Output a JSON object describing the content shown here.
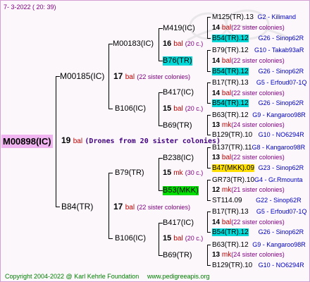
{
  "header": {
    "date": "7-  3-2022 ( 20: 39)"
  },
  "root": {
    "id": "M00898(IC)",
    "count": "19",
    "unit": "bal",
    "note": "(Drones from 20 sister colonies)"
  },
  "g1": [
    {
      "id": "M00185(IC)",
      "count": "17",
      "unit": "bal",
      "note": "(22 sister colonies)"
    },
    {
      "id": "B84(TR)",
      "count": "17",
      "unit": "bal",
      "note": "(22 sister colonies)"
    }
  ],
  "g2": [
    {
      "id": "M00183(IC)"
    },
    {
      "id": "B106(IC)",
      "count": "15",
      "unit": "bal",
      "note": "(20 c.)"
    },
    {
      "id": "B79(TR)",
      "count": "15",
      "unit": "mk",
      "note": "(30 c.)"
    },
    {
      "id": "B106(IC)",
      "count": "15",
      "unit": "bal",
      "note": "(20 c.)"
    }
  ],
  "g3": [
    {
      "id": "M419(IC)",
      "count": "16",
      "unit": "bal",
      "note": "(20 c.)"
    },
    {
      "id": "B76(TR)"
    },
    {
      "id": "B417(IC)"
    },
    {
      "id": "B69(TR)"
    },
    {
      "id": "B238(IC)"
    },
    {
      "id": "B53(MKK)"
    },
    {
      "id": "B417(IC)"
    },
    {
      "id": "B69(TR)"
    }
  ],
  "g4": [
    {
      "id": "M125(TR).13",
      "origin": "G2 - Kilimand"
    },
    {
      "count": "14",
      "unit": "bal",
      "note": "(22 sister colonies)"
    },
    {
      "id": "B54(TR).12",
      "origin": "G26 - Sinop62R"
    },
    {
      "id": "B79(TR).12",
      "origin": "G10 - Takab93aR"
    },
    {
      "count": "14",
      "unit": "bal",
      "note": "(22 sister colonies)"
    },
    {
      "id": "B54(TR).12",
      "origin": "G26 - Sinop62R"
    },
    {
      "id": "B17(TR).13",
      "origin": "G5 - Erfoud07-1Q"
    },
    {
      "count": "14",
      "unit": "bal",
      "note": "(22 sister colonies)"
    },
    {
      "id": "B54(TR).12",
      "origin": "G26 - Sinop62R"
    },
    {
      "id": "B63(TR).12",
      "origin": "G9 - Kangaroo98R"
    },
    {
      "count": "13",
      "unit": "mk",
      "note": "(24 sister colonies)"
    },
    {
      "id": "B129(TR).10",
      "origin": "G10 - NO6294R"
    },
    {
      "id": "B137(TR).11",
      "origin": "G8 - Kangaroo98R"
    },
    {
      "count": "13",
      "unit": "bal",
      "note": "(22 sister colonies)"
    },
    {
      "id": "B47(MKK).09",
      "origin": "G23 - Sinop62R"
    },
    {
      "id": "GR73(TR).10",
      "origin": "G4 - Gr.Rmounta"
    },
    {
      "count": "12",
      "unit": "mk",
      "note": "(21 sister colonies)"
    },
    {
      "id": "ST114.09",
      "origin": "G22 - Sinop62R"
    },
    {
      "id": "B17(TR).13",
      "origin": "G5 - Erfoud07-1Q"
    },
    {
      "count": "14",
      "unit": "bal",
      "note": "(22 sister colonies)"
    },
    {
      "id": "B54(TR).12",
      "origin": "G26 - Sinop62R"
    },
    {
      "id": "B63(TR).12",
      "origin": "G9 - Kangaroo98R"
    },
    {
      "count": "13",
      "unit": "mk",
      "note": "(24 sister colonies)"
    },
    {
      "id": "B129(TR).10",
      "origin": "G10 - NO6294R"
    }
  ],
  "footer": {
    "copyright": "Copyright 2004-2022 @ Karl Kehrle Foundation",
    "site": "www.pedigreeapis.org"
  },
  "colors": {
    "root_bg": "#f0b4f0",
    "cyan": "#00d8d8",
    "yellow": "#ffe000",
    "green": "#00dd00",
    "bal_red": "#c00000",
    "colony_blue": "#0000c0"
  }
}
